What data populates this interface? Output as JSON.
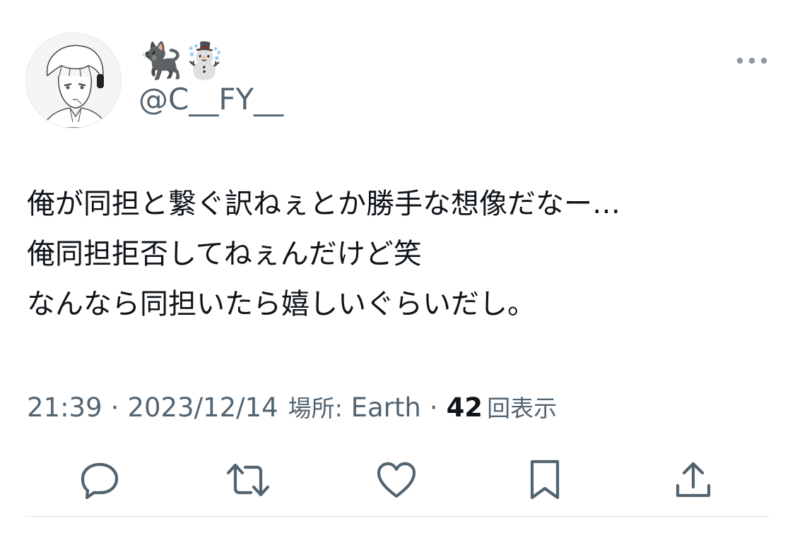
{
  "tweet": {
    "display_name": "🐈‍⬛☃️",
    "username": "@C__FY__",
    "text_lines": [
      "俺が同担と繋ぐ訳ねぇとか勝手な想像だなー…",
      "俺同担拒否してねぇんだけど笑",
      "なんなら同担いたら嬉しいぐらいだし。"
    ],
    "time": "21:39",
    "date": "2023/12/14",
    "location_label": "場所:",
    "location": "Earth",
    "views_count": "42",
    "views_label": "回表示",
    "separator": "·"
  },
  "icons": {
    "more": "more-horizontal-icon",
    "reply": "reply-icon",
    "retweet": "retweet-icon",
    "like": "heart-icon",
    "bookmark": "bookmark-icon",
    "share": "share-icon"
  },
  "colors": {
    "text_primary": "#0f1419",
    "text_secondary": "#536471",
    "icon": "#536471",
    "divider": "#dde3e7"
  }
}
